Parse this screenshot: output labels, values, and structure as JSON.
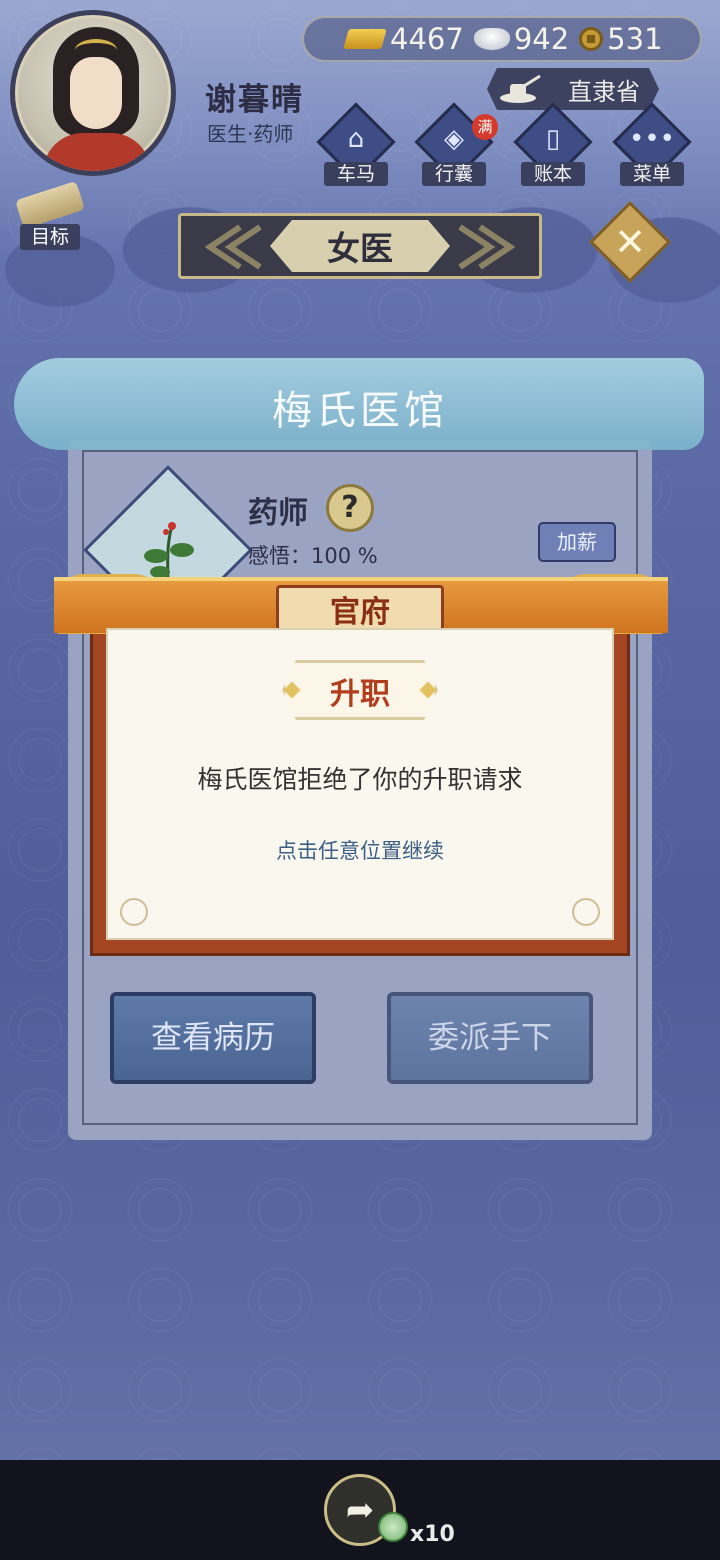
{
  "player": {
    "name": "谢暮晴",
    "role": "医生·药师"
  },
  "currency": {
    "gold": "4467",
    "silver": "942",
    "coins": "531"
  },
  "province": "直隶省",
  "nav": [
    {
      "label": "车马"
    },
    {
      "label": "行囊",
      "badge": "满"
    },
    {
      "label": "账本"
    },
    {
      "label": "菜单"
    }
  ],
  "goal_label": "目标",
  "page_title": "女医",
  "hospital": {
    "name": "梅氏医馆",
    "job": "药师",
    "help": "?",
    "insight": "感悟：100 %",
    "raise_label": "加薪",
    "view_records": "查看病历",
    "assign_staff": "委派手下"
  },
  "modal": {
    "header": "官府",
    "title": "升职",
    "message": "梅氏医馆拒绝了你的升职请求",
    "hint": "点击任意位置继续"
  },
  "bottom": {
    "share_count": "x10"
  }
}
